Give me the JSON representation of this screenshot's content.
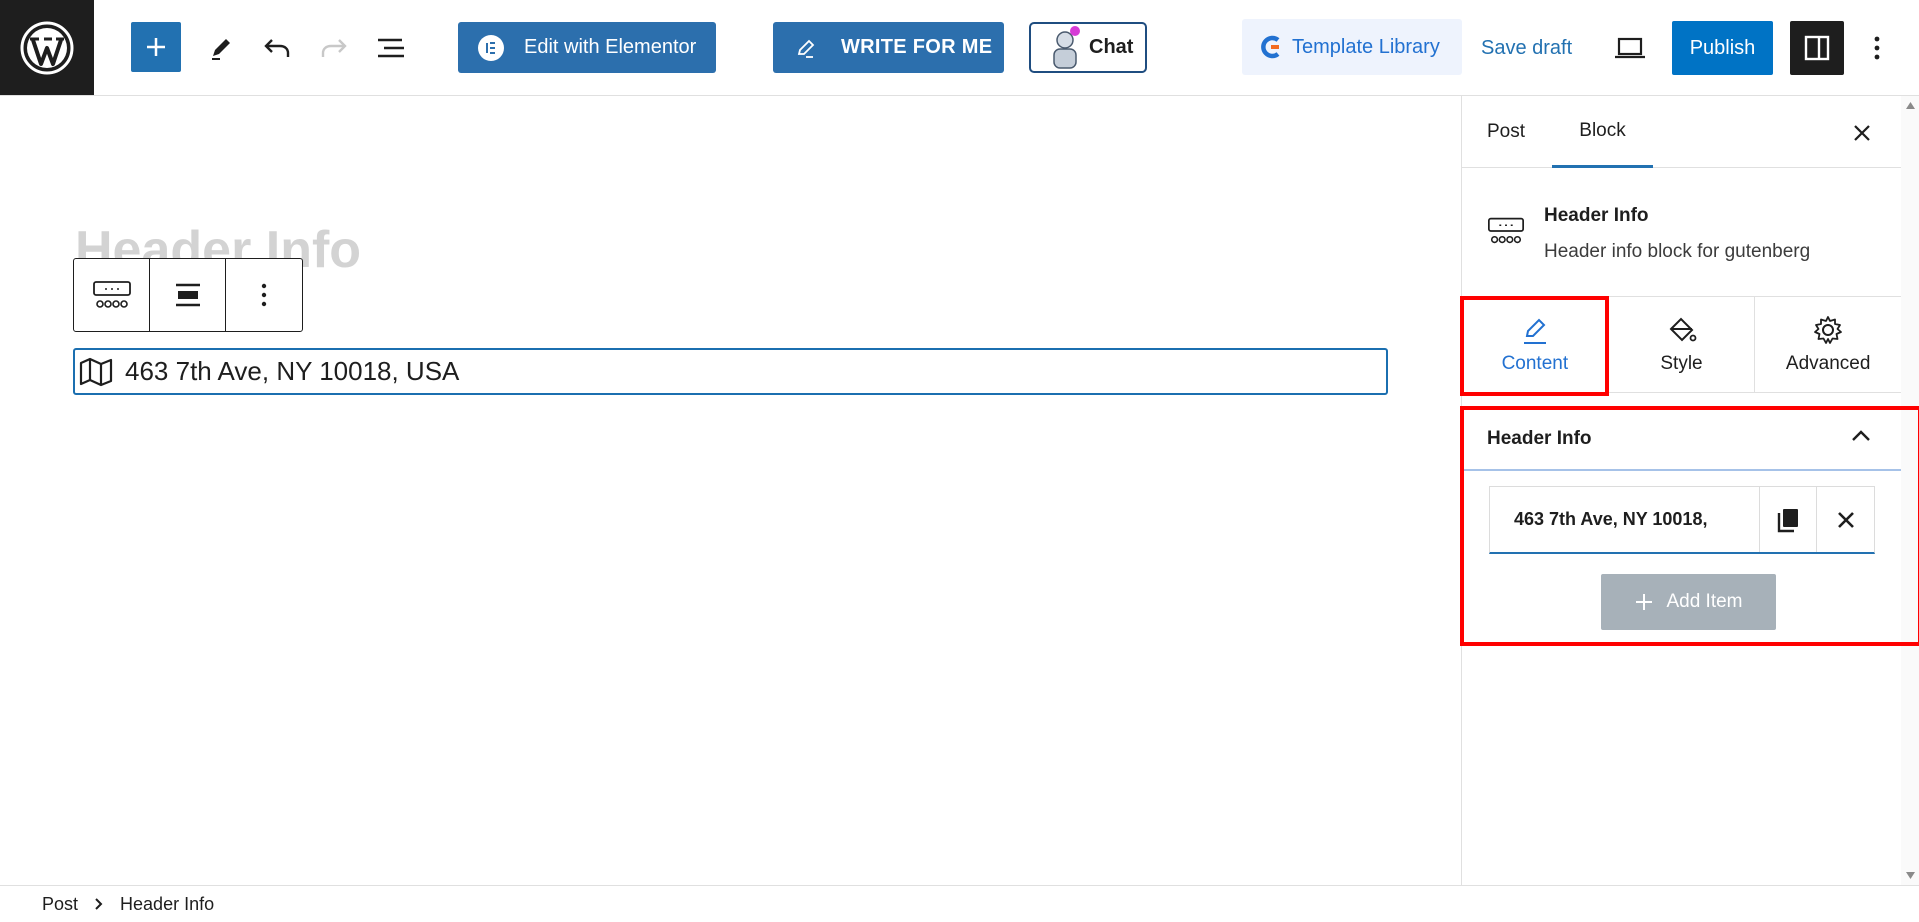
{
  "toolbar": {
    "edit_elementor_label": "Edit with Elementor",
    "write_for_me_label": "WRITE FOR ME",
    "chat_label": "Chat",
    "template_library_label": "Template Library",
    "save_draft_label": "Save draft",
    "publish_label": "Publish"
  },
  "editor": {
    "post_title": "Header Info",
    "header_block_text": "463 7th Ave, NY 10018, USA"
  },
  "sidebar": {
    "tabs": {
      "post": "Post",
      "block": "Block"
    },
    "block_card": {
      "name": "Header Info",
      "description": "Header info block for gutenberg"
    },
    "panel_tabs": {
      "content": "Content",
      "style": "Style",
      "advanced": "Advanced"
    },
    "section_title": "Header Info",
    "items": [
      {
        "text": "463 7th Ave, NY 10018,"
      }
    ],
    "add_item_label": "Add Item"
  },
  "breadcrumb": {
    "root": "Post",
    "current": "Header Info"
  },
  "colors": {
    "accent": "#2271b1",
    "publish": "#0073c5",
    "highlight": "#ff0000",
    "active_tab": "#2271d1"
  }
}
